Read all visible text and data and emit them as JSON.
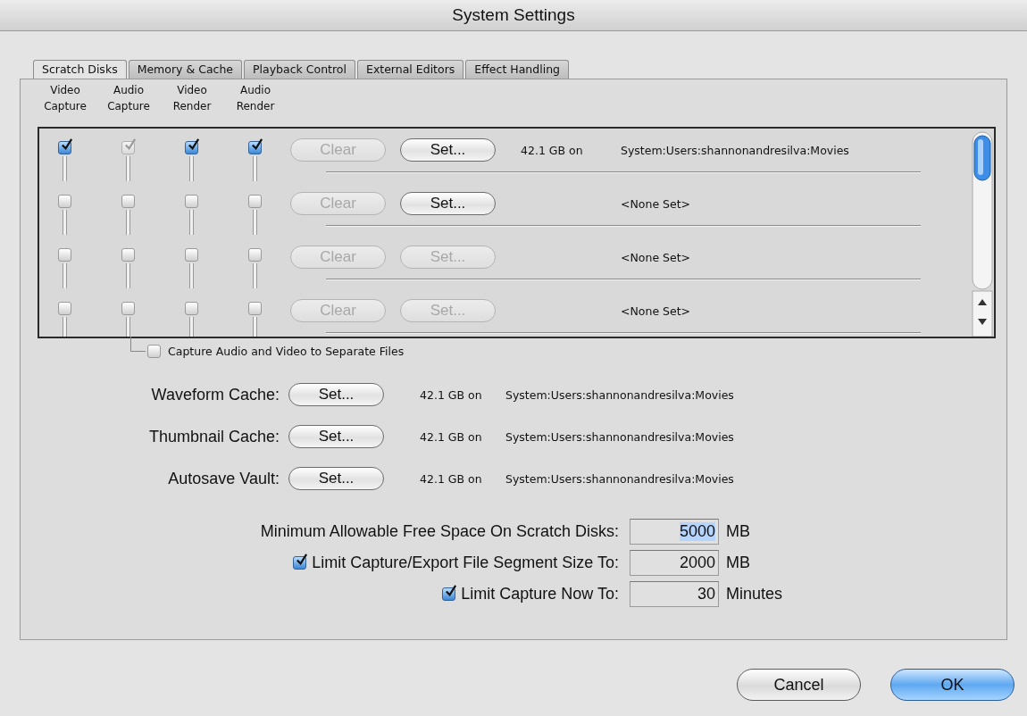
{
  "window": {
    "title": "System Settings"
  },
  "tabs": [
    {
      "label": "Scratch Disks",
      "selected": true
    },
    {
      "label": "Memory & Cache",
      "selected": false
    },
    {
      "label": "Playback Control",
      "selected": false
    },
    {
      "label": "External Editors",
      "selected": false
    },
    {
      "label": "Effect Handling",
      "selected": false
    }
  ],
  "columns": [
    [
      "Video",
      "Capture"
    ],
    [
      "Audio",
      "Capture"
    ],
    [
      "Video",
      "Render"
    ],
    [
      "Audio",
      "Render"
    ]
  ],
  "scratch_disks": [
    {
      "checkboxes": [
        {
          "checked": true,
          "disabled": false
        },
        {
          "checked": true,
          "disabled": true
        },
        {
          "checked": true,
          "disabled": false
        },
        {
          "checked": true,
          "disabled": false
        }
      ],
      "clear": {
        "label": "Clear",
        "disabled": true
      },
      "set": {
        "label": "Set...",
        "disabled": false
      },
      "size": "42.1 GB on",
      "path": "System:Users:shannonandresilva:Movies"
    },
    {
      "checkboxes": [
        {
          "checked": false,
          "disabled": false
        },
        {
          "checked": false,
          "disabled": false
        },
        {
          "checked": false,
          "disabled": false
        },
        {
          "checked": false,
          "disabled": false
        }
      ],
      "clear": {
        "label": "Clear",
        "disabled": true
      },
      "set": {
        "label": "Set...",
        "disabled": false
      },
      "path": "<None Set>"
    },
    {
      "checkboxes": [
        {
          "checked": false,
          "disabled": false
        },
        {
          "checked": false,
          "disabled": false
        },
        {
          "checked": false,
          "disabled": false
        },
        {
          "checked": false,
          "disabled": false
        }
      ],
      "clear": {
        "label": "Clear",
        "disabled": true
      },
      "set": {
        "label": "Set...",
        "disabled": true
      },
      "path": "<None Set>"
    },
    {
      "checkboxes": [
        {
          "checked": false,
          "disabled": false
        },
        {
          "checked": false,
          "disabled": false
        },
        {
          "checked": false,
          "disabled": false
        },
        {
          "checked": false,
          "disabled": false
        }
      ],
      "clear": {
        "label": "Clear",
        "disabled": true
      },
      "set": {
        "label": "Set...",
        "disabled": true
      },
      "path": "<None Set>"
    }
  ],
  "separate_files": {
    "label": "Capture Audio and Video to Separate Files",
    "checked": false
  },
  "caches": [
    {
      "label": "Waveform Cache:",
      "button": "Set...",
      "size": "42.1 GB on",
      "path": "System:Users:shannonandresilva:Movies"
    },
    {
      "label": "Thumbnail Cache:",
      "button": "Set...",
      "size": "42.1 GB on",
      "path": "System:Users:shannonandresilva:Movies"
    },
    {
      "label": "Autosave Vault:",
      "button": "Set...",
      "size": "42.1 GB on",
      "path": "System:Users:shannonandresilva:Movies"
    }
  ],
  "limits": [
    {
      "kind": "plain",
      "label": "Minimum Allowable Free Space On Scratch Disks:",
      "value": "5000",
      "selected": true,
      "unit": "MB"
    },
    {
      "kind": "checkbox",
      "checked": true,
      "label": "Limit Capture/Export File Segment Size To:",
      "value": "2000",
      "selected": false,
      "unit": "MB"
    },
    {
      "kind": "checkbox",
      "checked": true,
      "label": "Limit Capture Now To:",
      "value": "30",
      "selected": false,
      "unit": "Minutes"
    }
  ],
  "buttons": [
    {
      "label": "Cancel",
      "default": false
    },
    {
      "label": "OK",
      "default": true
    }
  ]
}
